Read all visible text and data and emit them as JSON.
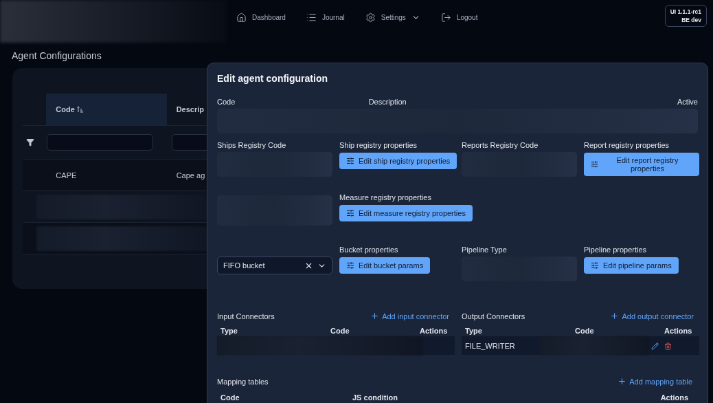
{
  "nav": {
    "items": [
      {
        "label": "Dashboard",
        "kind": "link"
      },
      {
        "label": "Journal",
        "kind": "link"
      },
      {
        "label": "Settings",
        "kind": "menu"
      },
      {
        "label": "Logout",
        "kind": "link"
      }
    ]
  },
  "version_badge": [
    "UI 1.1.1-rc1",
    "BE dev"
  ],
  "page_title": "Agent Configurations",
  "table": {
    "columns": [
      {
        "label": "Code",
        "selected": true
      },
      {
        "label": "Descrip",
        "selected": false
      }
    ],
    "rows": [
      [
        "CAPE",
        "Cape ag"
      ]
    ]
  },
  "dialog": {
    "title": "Edit agent configuration",
    "top_labels": [
      "Code",
      "Description",
      "Active"
    ],
    "grid": [
      [
        {
          "kind": "field",
          "label": "Ships Registry Code"
        },
        {
          "kind": "button",
          "label": "Ship registry properties",
          "button": "Edit ship registry properties"
        },
        {
          "kind": "field",
          "label": "Reports Registry Code"
        },
        {
          "kind": "button",
          "label": "Report registry properties",
          "button": "Edit report registry properties"
        }
      ],
      [
        {
          "kind": "field"
        },
        {
          "kind": "button",
          "label": "Measure registry properties",
          "button": "Edit measure registry properties"
        }
      ],
      [
        {
          "kind": "select",
          "value": "FIFO bucket"
        },
        {
          "kind": "button",
          "label": "Bucket properties",
          "button": "Edit bucket params"
        },
        {
          "kind": "field",
          "label": "Pipeline Type"
        },
        {
          "kind": "button",
          "label": "Pipeline properties",
          "button": "Edit pipeline params"
        }
      ]
    ],
    "connectors": [
      {
        "title": "Input Connectors",
        "add": "Add input connector",
        "columns": [
          "Type",
          "Code",
          "Actions"
        ]
      },
      {
        "title": "Output Connectors",
        "add": "Add output connector",
        "columns": [
          "Type",
          "Code",
          "Actions"
        ],
        "rows": [
          {
            "type": "FILE_WRITER"
          }
        ]
      }
    ],
    "mapping": {
      "title": "Mapping tables",
      "add": "Add mapping table",
      "columns": [
        "Code",
        "JS condition",
        "Actions"
      ]
    }
  }
}
